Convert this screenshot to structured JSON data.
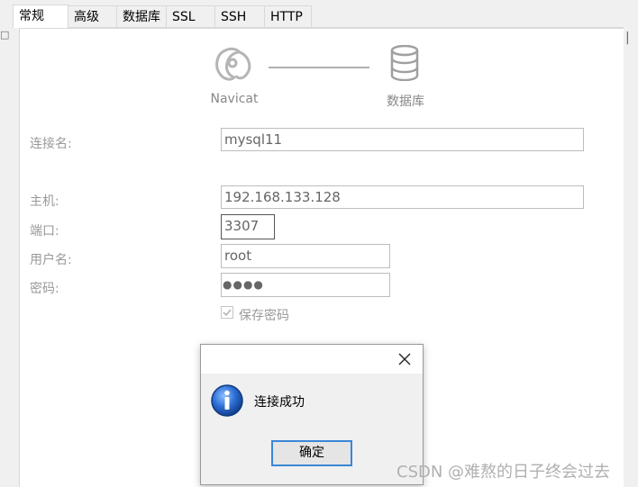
{
  "tabs": [
    {
      "label": "常规",
      "active": true
    },
    {
      "label": "高级"
    },
    {
      "label": "数据库"
    },
    {
      "label": "SSL"
    },
    {
      "label": "SSH"
    },
    {
      "label": "HTTP"
    }
  ],
  "diagram": {
    "left_caption": "Navicat",
    "right_caption": "数据库",
    "left_icon": "navicat-logo-icon",
    "right_icon": "database-icon"
  },
  "form": {
    "conn_name_label": "连接名:",
    "conn_name_value": "mysql11",
    "host_label": "主机:",
    "host_value": "192.168.133.128",
    "port_label": "端口:",
    "port_value": "3307",
    "user_label": "用户名:",
    "user_value": "root",
    "password_label": "密码:",
    "password_mask": "●●●●",
    "save_password_label": "保存密码",
    "save_password_checked": true
  },
  "dialog": {
    "message": "连接成功",
    "ok_label": "确定",
    "icon": "info-icon",
    "close_icon": "close-icon"
  },
  "watermark": "CSDN @难熬的日子终会过去",
  "colors": {
    "accent": "#3b86d6",
    "info_blue": "#1f5fbf"
  }
}
